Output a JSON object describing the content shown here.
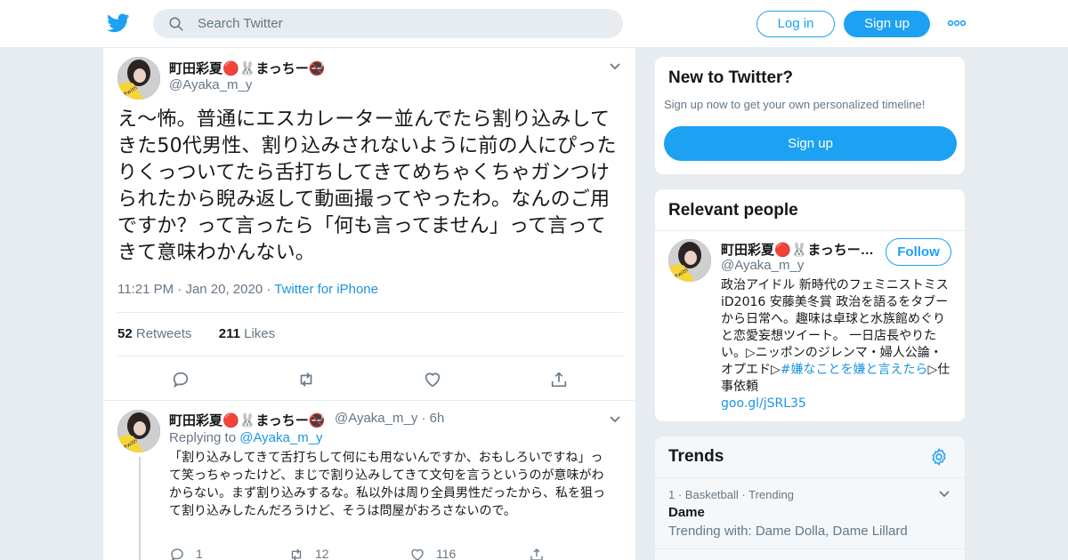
{
  "header": {
    "search_placeholder": "Search Twitter",
    "login_label": "Log in",
    "signup_label": "Sign up",
    "brand_color": "#1da1f2"
  },
  "tweet": {
    "author_name": "町田彩夏🔴🐰まっちー🚭",
    "author_handle": "@Ayaka_m_y",
    "text": "え〜怖。普通にエスカレーター並んでたら割り込みしてきた50代男性、割り込みされないように前の人にぴったりくっついてたら舌打ちしてきてめちゃくちゃガンつけられたから睨み返して動画撮ってやったわ。なんのご用ですか？って言ったら「何も言ってません」って言ってきて意味わかんない。",
    "time": "11:21 PM",
    "date": "Jan 20, 2020",
    "source": "Twitter for iPhone",
    "retweets_count": "52",
    "retweets_label": "Retweets",
    "likes_count": "211",
    "likes_label": "Likes",
    "dot": "·"
  },
  "reply": {
    "author_name": "町田彩夏🔴🐰まっちー🚭",
    "author_handle": "@Ayaka_m_y",
    "age": "6h",
    "replying_label": "Replying to",
    "replying_to": "@Ayaka_m_y",
    "text": "「割り込みしてきて舌打ちして何にも用ないんですか、おもしろいですね」って笑っちゃったけど、まじで割り込みしてきて文句を言うというのが意味がわからない。まず割り込みするな。私以外は周り全員男性だったから、私を狙って割り込みしたんだろうけど、そうは問屋がおろさないので。",
    "replies": "1",
    "retweets": "12",
    "likes": "116",
    "dot": "·"
  },
  "new_to_twitter": {
    "title": "New to Twitter?",
    "subtitle": "Sign up now to get your own personalized timeline!",
    "button": "Sign up"
  },
  "relevant_people": {
    "title": "Relevant people",
    "name": "町田彩夏🔴🐰まっちー…",
    "handle": "@Ayaka_m_y",
    "follow_label": "Follow",
    "bio_text": "政治アイドル 新時代のフェミニストミスiD2016 安藤美冬賞 政治を語るをタブーから日常へ。趣味は卓球と水族館めぐりと恋愛妄想ツイート。 一日店長やりたい。▷ニッポンのジレンマ・婦人公論・オプエド▷",
    "bio_hashtag": "#嫌なことを嫌と言えたら",
    "bio_after": "▷仕事依頼",
    "bio_link": "goo.gl/jSRL35"
  },
  "trends": {
    "title": "Trends",
    "items": [
      {
        "rank": "1",
        "category": "Basketball",
        "status": "Trending",
        "name": "Dame",
        "with": "Trending with: Dame Dolla, Dame Lillard"
      }
    ]
  },
  "icons": [
    "twitter-logo-icon",
    "search-icon",
    "more-dots-icon",
    "chevron-down-icon",
    "reply-icon",
    "retweet-icon",
    "like-icon",
    "share-icon",
    "gear-icon"
  ]
}
